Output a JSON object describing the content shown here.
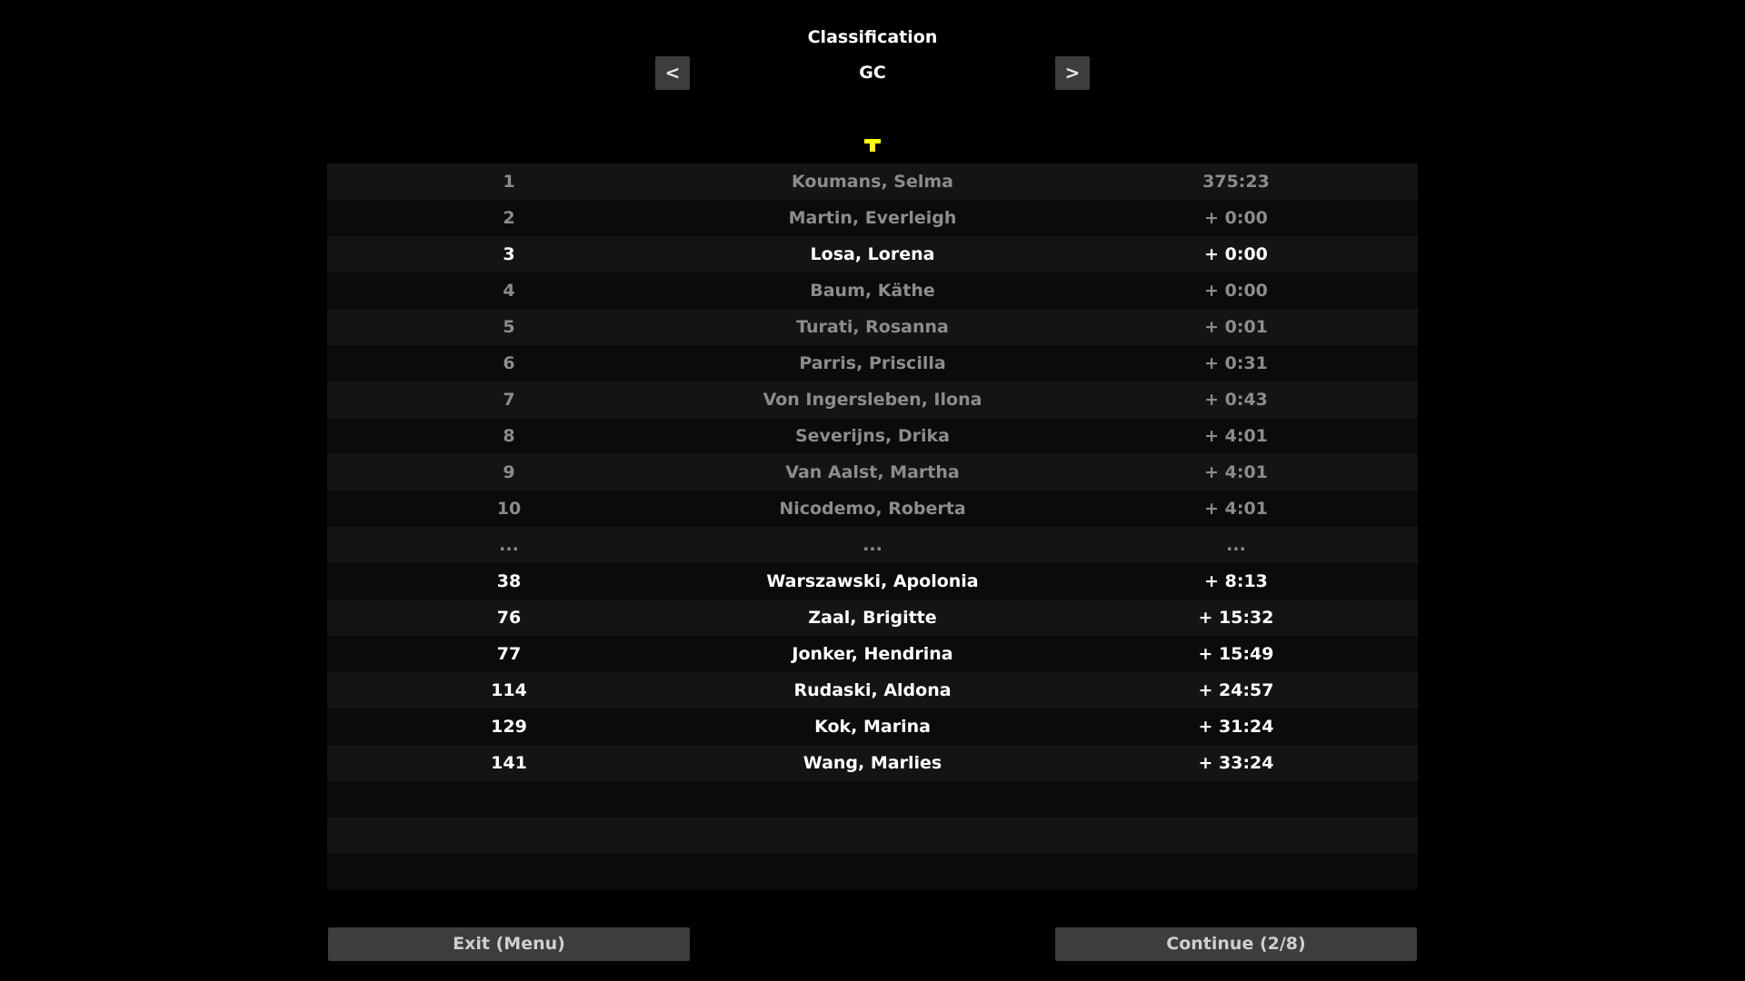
{
  "header": {
    "title": "Classification",
    "subtitle": "GC",
    "prev_label": "<",
    "next_label": ">"
  },
  "leader_icon": {
    "icon": "jersey-icon",
    "color": "#ffff00"
  },
  "rows": [
    {
      "pos": "1",
      "name": "Koumans, Selma",
      "time": "375:23",
      "style": "dim"
    },
    {
      "pos": "2",
      "name": "Martin, Everleigh",
      "time": "+ 0:00",
      "style": "dim"
    },
    {
      "pos": "3",
      "name": "Losa, Lorena",
      "time": "+ 0:00",
      "style": "bright"
    },
    {
      "pos": "4",
      "name": "Baum, Käthe",
      "time": "+ 0:00",
      "style": "dim"
    },
    {
      "pos": "5",
      "name": "Turati, Rosanna",
      "time": "+ 0:01",
      "style": "dim"
    },
    {
      "pos": "6",
      "name": "Parris, Priscilla",
      "time": "+ 0:31",
      "style": "dim"
    },
    {
      "pos": "7",
      "name": "Von Ingersleben, Ilona",
      "time": "+ 0:43",
      "style": "dim"
    },
    {
      "pos": "8",
      "name": "Severijns, Drika",
      "time": "+ 4:01",
      "style": "dim"
    },
    {
      "pos": "9",
      "name": "Van Aalst, Martha",
      "time": "+ 4:01",
      "style": "dim"
    },
    {
      "pos": "10",
      "name": "Nicodemo, Roberta",
      "time": "+ 4:01",
      "style": "dim"
    },
    {
      "pos": "...",
      "name": "...",
      "time": "...",
      "style": "dim"
    },
    {
      "pos": "38",
      "name": "Warszawski, Apolonia",
      "time": "+ 8:13",
      "style": "bright"
    },
    {
      "pos": "76",
      "name": "Zaal, Brigitte",
      "time": "+ 15:32",
      "style": "bright"
    },
    {
      "pos": "77",
      "name": "Jonker, Hendrina",
      "time": "+ 15:49",
      "style": "bright"
    },
    {
      "pos": "114",
      "name": "Rudaski, Aldona",
      "time": "+ 24:57",
      "style": "bright"
    },
    {
      "pos": "129",
      "name": "Kok, Marina",
      "time": "+ 31:24",
      "style": "bright"
    },
    {
      "pos": "141",
      "name": "Wang, Marlies",
      "time": "+ 33:24",
      "style": "bright"
    },
    {
      "pos": "",
      "name": "",
      "time": "",
      "style": "dim"
    },
    {
      "pos": "",
      "name": "",
      "time": "",
      "style": "dim"
    },
    {
      "pos": "",
      "name": "",
      "time": "",
      "style": "dim"
    }
  ],
  "footer": {
    "exit_label": "Exit (Menu)",
    "continue_label": "Continue (2/8)"
  }
}
